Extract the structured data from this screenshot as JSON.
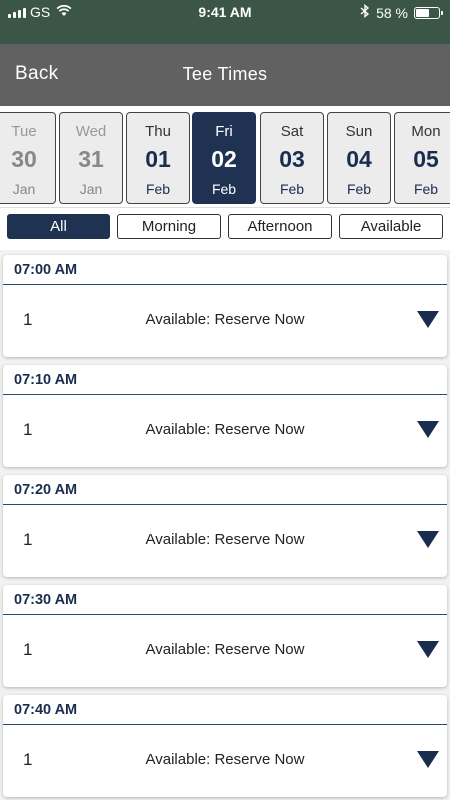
{
  "status_bar": {
    "carrier": "GS",
    "time": "9:41 AM",
    "battery_text": "58 %",
    "battery_level": 0.58,
    "icons": [
      "signal-icon",
      "wifi-icon",
      "bluetooth-icon",
      "battery-icon"
    ]
  },
  "nav": {
    "back_label": "Back",
    "title": "Tee Times"
  },
  "dates": [
    {
      "dow": "Tue",
      "day": "30",
      "month": "Jan",
      "state": "past"
    },
    {
      "dow": "Wed",
      "day": "31",
      "month": "Jan",
      "state": "past"
    },
    {
      "dow": "Thu",
      "day": "01",
      "month": "Feb",
      "state": "future"
    },
    {
      "dow": "Fri",
      "day": "02",
      "month": "Feb",
      "state": "selected"
    },
    {
      "dow": "Sat",
      "day": "03",
      "month": "Feb",
      "state": "future"
    },
    {
      "dow": "Sun",
      "day": "04",
      "month": "Feb",
      "state": "future"
    },
    {
      "dow": "Mon",
      "day": "05",
      "month": "Feb",
      "state": "future"
    }
  ],
  "filters": [
    {
      "label": "All",
      "active": true
    },
    {
      "label": "Morning",
      "active": false
    },
    {
      "label": "Afternoon",
      "active": false
    },
    {
      "label": "Available",
      "active": false
    }
  ],
  "tee_times": [
    {
      "time": "07:00 AM",
      "players": "1",
      "status": "Available: Reserve Now"
    },
    {
      "time": "07:10 AM",
      "players": "1",
      "status": "Available: Reserve Now"
    },
    {
      "time": "07:20 AM",
      "players": "1",
      "status": "Available: Reserve Now"
    },
    {
      "time": "07:30 AM",
      "players": "1",
      "status": "Available: Reserve Now"
    },
    {
      "time": "07:40 AM",
      "players": "1",
      "status": "Available: Reserve Now"
    }
  ],
  "colors": {
    "status_bar": "#3b5546",
    "nav_bar": "#616161",
    "accent": "#1f3252"
  }
}
